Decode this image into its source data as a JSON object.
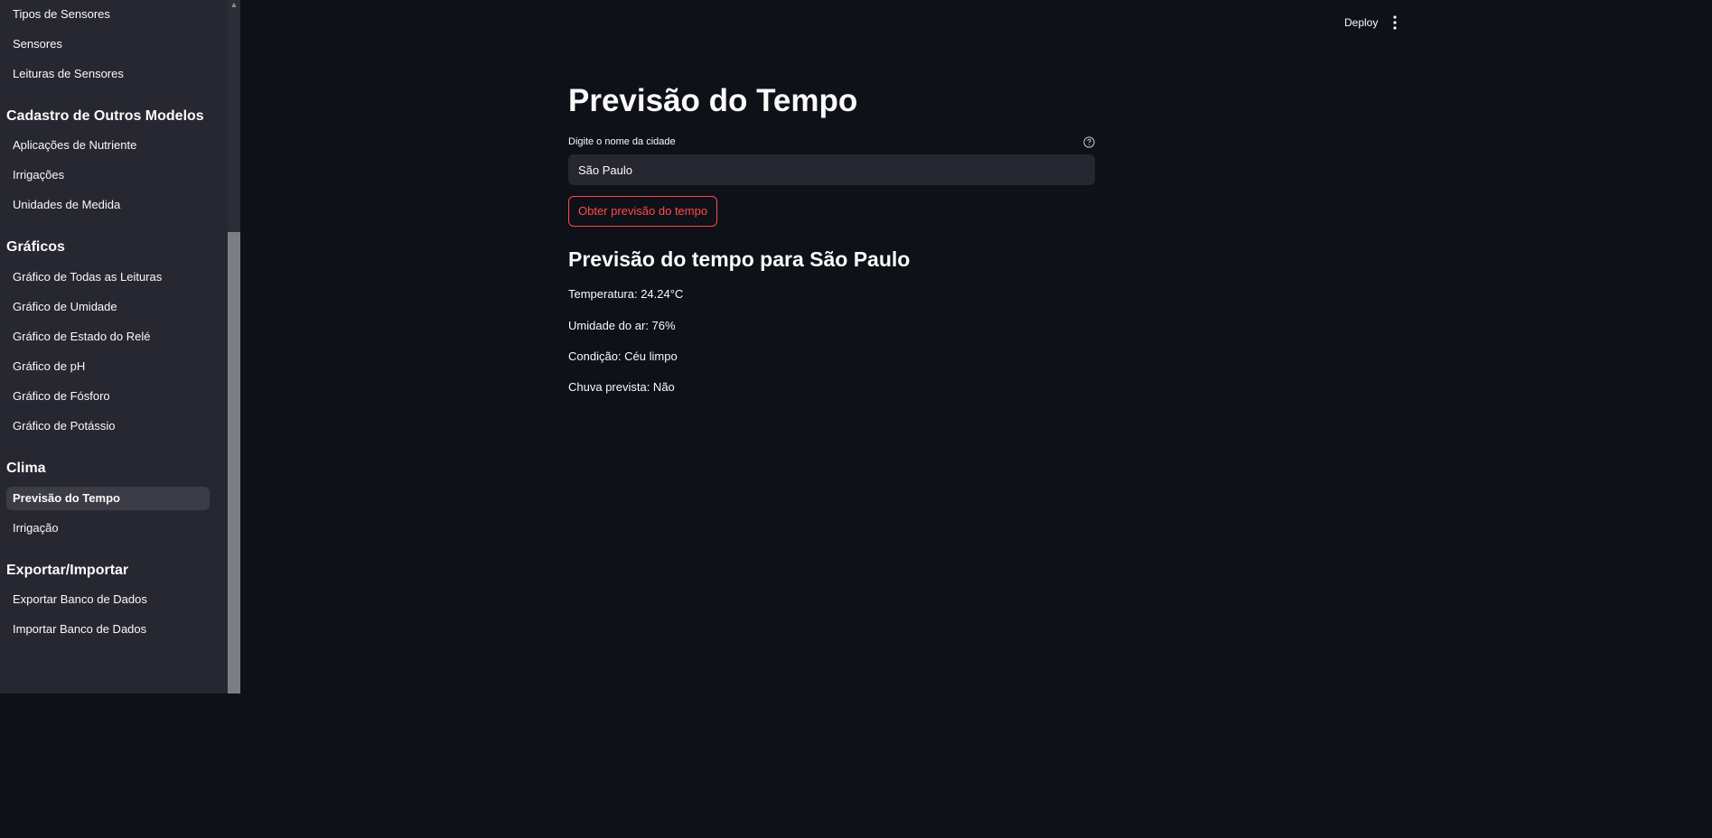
{
  "sidebar": {
    "items": [
      {
        "type": "item",
        "label": "Tipos de Sensores"
      },
      {
        "type": "item",
        "label": "Sensores"
      },
      {
        "type": "item",
        "label": "Leituras de Sensores"
      },
      {
        "type": "header",
        "label": "Cadastro de Outros Modelos"
      },
      {
        "type": "item",
        "label": "Aplicações de Nutriente"
      },
      {
        "type": "item",
        "label": "Irrigações"
      },
      {
        "type": "item",
        "label": "Unidades de Medida"
      },
      {
        "type": "header",
        "label": "Gráficos"
      },
      {
        "type": "item",
        "label": "Gráfico de Todas as Leituras"
      },
      {
        "type": "item",
        "label": "Gráfico de Umidade"
      },
      {
        "type": "item",
        "label": "Gráfico de Estado do Relé"
      },
      {
        "type": "item",
        "label": "Gráfico de pH"
      },
      {
        "type": "item",
        "label": "Gráfico de Fósforo"
      },
      {
        "type": "item",
        "label": "Gráfico de Potássio"
      },
      {
        "type": "header",
        "label": "Clima"
      },
      {
        "type": "item",
        "label": "Previsão do Tempo",
        "active": true
      },
      {
        "type": "item",
        "label": "Irrigação"
      },
      {
        "type": "header",
        "label": "Exportar/Importar"
      },
      {
        "type": "item",
        "label": "Exportar Banco de Dados"
      },
      {
        "type": "item",
        "label": "Importar Banco de Dados"
      }
    ]
  },
  "toolbar": {
    "deploy_label": "Deploy",
    "menu_icon": "more-vertical-icon"
  },
  "main": {
    "title": "Previsão do Tempo",
    "city_field": {
      "label": "Digite o nome da cidade",
      "value": "São Paulo",
      "help_icon": "question-circle-icon"
    },
    "submit_label": "Obter previsão do tempo",
    "result": {
      "heading": "Previsão do tempo para São Paulo",
      "temperature": "Temperatura: 24.24°C",
      "humidity": "Umidade do ar: 76%",
      "condition": "Condição: Céu limpo",
      "rain": "Chuva prevista: Não"
    }
  },
  "colors": {
    "background": "#0e1117",
    "sidebar": "#262730",
    "accent": "#ff4b4b",
    "text": "#fafafa"
  }
}
